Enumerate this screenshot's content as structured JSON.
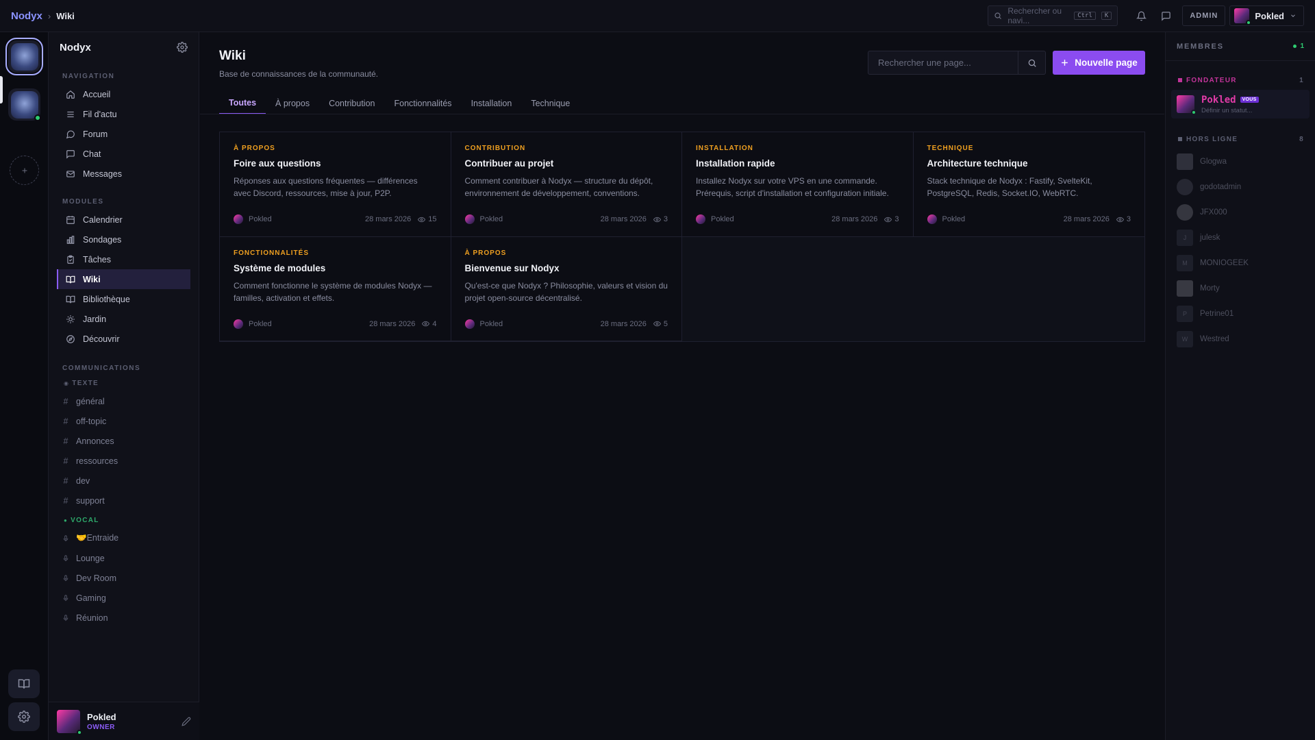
{
  "topbar": {
    "brand": "Nodyx",
    "separator": "›",
    "page": "Wiki",
    "search_placeholder": "Rechercher ou navi...",
    "kbd_ctrl": "Ctrl",
    "kbd_k": "K",
    "admin_label": "ADMIN",
    "user_name": "Pokled"
  },
  "sidebar": {
    "server_name": "Nodyx",
    "nav_title": "NAVIGATION",
    "nav_items": [
      {
        "label": "Accueil",
        "icon": "home-icon"
      },
      {
        "label": "Fil d'actu",
        "icon": "list-icon"
      },
      {
        "label": "Forum",
        "icon": "forum-icon"
      },
      {
        "label": "Chat",
        "icon": "chat-icon"
      },
      {
        "label": "Messages",
        "icon": "mail-icon"
      }
    ],
    "modules_title": "MODULES",
    "module_items": [
      {
        "label": "Calendrier",
        "icon": "calendar-icon"
      },
      {
        "label": "Sondages",
        "icon": "poll-icon"
      },
      {
        "label": "Tâches",
        "icon": "tasks-icon"
      },
      {
        "label": "Wiki",
        "icon": "book-icon",
        "active": true
      },
      {
        "label": "Bibliothèque",
        "icon": "library-icon"
      },
      {
        "label": "Jardin",
        "icon": "garden-icon"
      },
      {
        "label": "Découvrir",
        "icon": "compass-icon"
      }
    ],
    "comms_title": "COMMUNICATIONS",
    "text_title": "TEXTE",
    "text_channels": [
      "général",
      "off-topic",
      "Annonces",
      "ressources",
      "dev",
      "support"
    ],
    "voice_title": "VOCAL",
    "voice_channels": [
      "🤝Entraide",
      "Lounge",
      "Dev Room",
      "Gaming",
      "Réunion"
    ],
    "footer": {
      "name": "Pokled",
      "role": "OWNER"
    }
  },
  "main": {
    "title": "Wiki",
    "subtitle": "Base de connaissances de la communauté.",
    "search_placeholder": "Rechercher une page...",
    "new_page_label": "Nouvelle page",
    "tabs": [
      "Toutes",
      "À propos",
      "Contribution",
      "Fonctionnalités",
      "Installation",
      "Technique"
    ],
    "active_tab": 0,
    "cards": [
      {
        "category": "À PROPOS",
        "title": "Foire aux questions",
        "desc": "Réponses aux questions fréquentes — différences avec Discord, ressources, mise à jour, P2P.",
        "author": "Pokled",
        "date": "28 mars 2026",
        "views": "15"
      },
      {
        "category": "CONTRIBUTION",
        "title": "Contribuer au projet",
        "desc": "Comment contribuer à Nodyx — structure du dépôt, environnement de développement, conventions.",
        "author": "Pokled",
        "date": "28 mars 2026",
        "views": "3"
      },
      {
        "category": "INSTALLATION",
        "title": "Installation rapide",
        "desc": "Installez Nodyx sur votre VPS en une commande. Prérequis, script d'installation et configuration initiale.",
        "author": "Pokled",
        "date": "28 mars 2026",
        "views": "3"
      },
      {
        "category": "TECHNIQUE",
        "title": "Architecture technique",
        "desc": "Stack technique de Nodyx : Fastify, SvelteKit, PostgreSQL, Redis, Socket.IO, WebRTC.",
        "author": "Pokled",
        "date": "28 mars 2026",
        "views": "3"
      },
      {
        "category": "FONCTIONNALITÉS",
        "title": "Système de modules",
        "desc": "Comment fonctionne le système de modules Nodyx — familles, activation et effets.",
        "author": "Pokled",
        "date": "28 mars 2026",
        "views": "4"
      },
      {
        "category": "À PROPOS",
        "title": "Bienvenue sur Nodyx",
        "desc": "Qu'est-ce que Nodyx ? Philosophie, valeurs et vision du projet open-source décentralisé.",
        "author": "Pokled",
        "date": "28 mars 2026",
        "views": "5"
      }
    ]
  },
  "members": {
    "title": "MEMBRES",
    "online_count": "1",
    "founder_group": "FONDATEUR",
    "founder_count": "1",
    "founder": {
      "name": "Pokled",
      "badge": "VOUS",
      "status": "Définir un statut..."
    },
    "offline_group": "HORS LIGNE",
    "offline_count": "8",
    "offline": [
      {
        "name": "Glogwa",
        "initial": ""
      },
      {
        "name": "godotadmin",
        "initial": ""
      },
      {
        "name": "JFX000",
        "initial": ""
      },
      {
        "name": "julesk",
        "initial": "J"
      },
      {
        "name": "MONIOGEEK",
        "initial": "M"
      },
      {
        "name": "Morty",
        "initial": ""
      },
      {
        "name": "Petrine01",
        "initial": "P"
      },
      {
        "name": "Westred",
        "initial": "W"
      }
    ]
  },
  "colors": {
    "accent": "#8b5cf6",
    "button": "#8b4cf0",
    "category": "#f0a020",
    "online": "#2ecc71",
    "founder": "#e23ba8"
  }
}
